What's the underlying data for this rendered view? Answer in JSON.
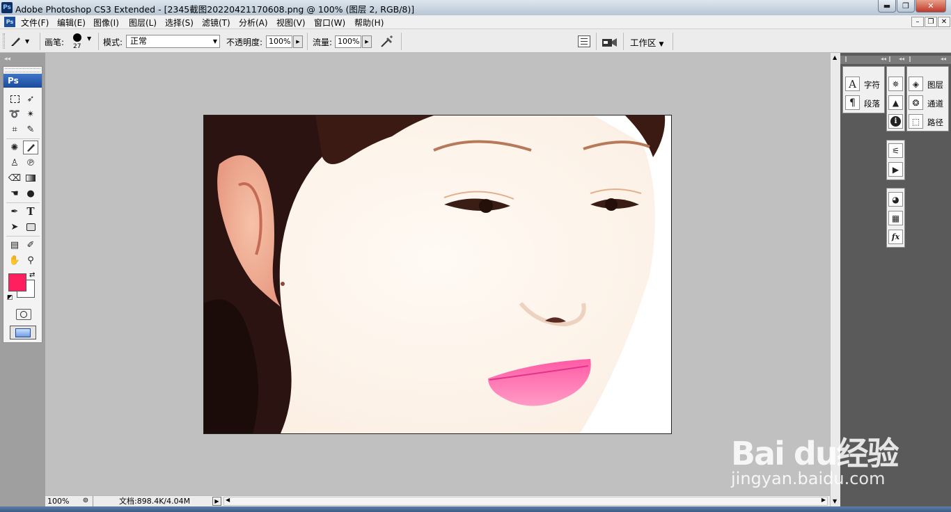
{
  "window": {
    "title": "Adobe Photoshop CS3 Extended - [2345截图20220421170608.png @ 100% (图层 2, RGB/8)]",
    "app_icon": "Ps"
  },
  "menu": [
    "文件(F)",
    "编辑(E)",
    "图像(I)",
    "图层(L)",
    "选择(S)",
    "滤镜(T)",
    "分析(A)",
    "视图(V)",
    "窗口(W)",
    "帮助(H)"
  ],
  "options": {
    "brush_label": "画笔:",
    "brush_size": "27",
    "mode_label": "模式:",
    "mode_value": "正常",
    "opacity_label": "不透明度:",
    "opacity_value": "100%",
    "flow_label": "流量:",
    "flow_value": "100%",
    "workspace_label": "工作区"
  },
  "toolbox": {
    "header": "Ps",
    "foreground_color": "#ff1f5e",
    "background_color": "#ffffff"
  },
  "status": {
    "zoom": "100%",
    "doc_info": "文档:898.4K/4.04M"
  },
  "panels": {
    "character": "字符",
    "paragraph": "段落",
    "layers": "图层",
    "channels": "通道",
    "paths": "路径"
  },
  "watermark": {
    "logo": "Bai du经验",
    "url": "jingyan.baidu.com"
  }
}
